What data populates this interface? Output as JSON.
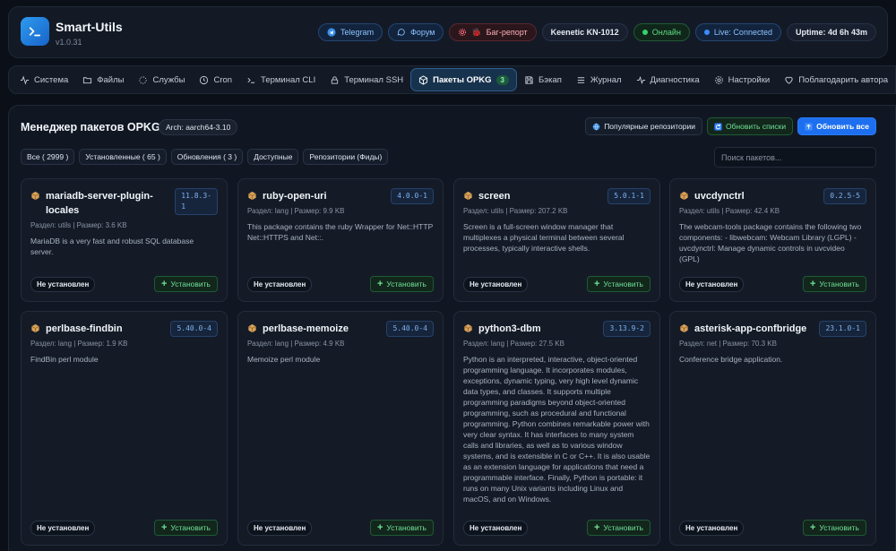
{
  "header": {
    "title": "Smart-Utils",
    "version": "v1.0.31",
    "badges": {
      "telegram": "Telegram",
      "forum": "Форум",
      "bugreport": "Баг-репорт",
      "device": "Keenetic KN-1012",
      "online": "Онлайн",
      "live": "Live: Connected",
      "uptime": "Uptime: 4d 6h 43m"
    },
    "colors": {
      "accent": "#2e9bf0",
      "online": "#36d26a",
      "live": "#3b8cff"
    }
  },
  "tabs": [
    {
      "label": "Система",
      "icon": "activity-icon"
    },
    {
      "label": "Файлы",
      "icon": "folder-icon"
    },
    {
      "label": "Службы",
      "icon": "spinner-icon"
    },
    {
      "label": "Cron",
      "icon": "clock-icon"
    },
    {
      "label": "Терминал CLI",
      "icon": "terminal-icon"
    },
    {
      "label": "Терминал SSH",
      "icon": "lock-icon"
    },
    {
      "label": "Пакеты OPKG",
      "icon": "package-icon",
      "active": true,
      "count": "3"
    },
    {
      "label": "Бэкап",
      "icon": "save-icon"
    },
    {
      "label": "Журнал",
      "icon": "list-icon"
    },
    {
      "label": "Диагностика",
      "icon": "pulse-icon"
    },
    {
      "label": "Настройки",
      "icon": "gear-icon"
    },
    {
      "label": "Поблагодарить автора",
      "icon": "heart-icon"
    }
  ],
  "panel": {
    "title": "Менеджер пакетов OPKG",
    "arch": "Arch: aarch64-3.10",
    "actions": {
      "popular": "Популярные репозитории",
      "update_lists": "Обновить списки",
      "update_all": "Обновить все"
    },
    "filters": {
      "all": "Все ( 2999 )",
      "installed": "Установленные ( 65 )",
      "updates": "Обновления ( 3 )",
      "available": "Доступные",
      "repos": "Репозитории (Фиды)"
    },
    "search_placeholder": "Поиск пакетов..."
  },
  "cards": [
    {
      "name": "mariadb-server-plugin-locales",
      "name_lines": [
        "mariadb-server-plugin-",
        "locales"
      ],
      "version": "11.8.3-1",
      "version_lines": [
        "11.8.3-",
        "1"
      ],
      "meta": "Раздел: utils | Размер: 3.6 KB",
      "desc": "MariaDB is a very fast and robust SQL database server.",
      "status": "Не установлен",
      "action": "Установить"
    },
    {
      "name": "ruby-open-uri",
      "version": "4.0.0-1",
      "meta": "Раздел: lang | Размер: 9.9 KB",
      "desc": "This package contains the ruby Wrapper for Net::HTTP Net::HTTPS and Net::.",
      "status": "Не установлен",
      "action": "Установить"
    },
    {
      "name": "screen",
      "version": "5.0.1-1",
      "meta": "Раздел: utils | Размер: 207.2 KB",
      "desc": "Screen is a full-screen window manager that multiplexes a physical terminal between several processes, typically interactive shells.",
      "status": "Не установлен",
      "action": "Установить"
    },
    {
      "name": "uvcdynctrl",
      "version": "0.2.5-5",
      "meta": "Раздел: utils | Размер: 42.4 KB",
      "desc": "The webcam-tools package contains the following two components: - libwebcam: Webcam Library (LGPL) - uvcdynctrl: Manage dynamic controls in uvcvideo (GPL)",
      "status": "Не установлен",
      "action": "Установить"
    },
    {
      "name": "perlbase-findbin",
      "version": "5.40.0-4",
      "meta": "Раздел: lang | Размер: 1.9 KB",
      "desc": "FindBin perl module",
      "status": "Не установлен",
      "action": "Установить"
    },
    {
      "name": "perlbase-memoize",
      "version": "5.40.0-4",
      "meta": "Раздел: lang | Размер: 4.9 KB",
      "desc": "Memoize perl module",
      "status": "Не установлен",
      "action": "Установить"
    },
    {
      "name": "python3-dbm",
      "version": "3.13.9-2",
      "meta": "Раздел: lang | Размер: 27.5 KB",
      "desc": "Python is an interpreted, interactive, object-oriented programming language. It incorporates modules, exceptions, dynamic typing, very high level dynamic data types, and classes. It supports multiple programming paradigms beyond object-oriented programming, such as procedural and functional programming. Python combines remarkable power with very clear syntax. It has interfaces to many system calls and libraries, as well as to various window systems, and is extensible in C or C++. It is also usable as an extension language for applications that need a programmable interface. Finally, Python is portable: it runs on many Unix variants including Linux and macOS, and on Windows.",
      "status": "Не установлен",
      "action": "Установить"
    },
    {
      "name": "asterisk-app-confbridge",
      "version": "23.1.0-1",
      "meta": "Раздел: net | Размер: 70.3 KB",
      "desc": "Conference bridge application.",
      "status": "Не установлен",
      "action": "Установить"
    }
  ]
}
